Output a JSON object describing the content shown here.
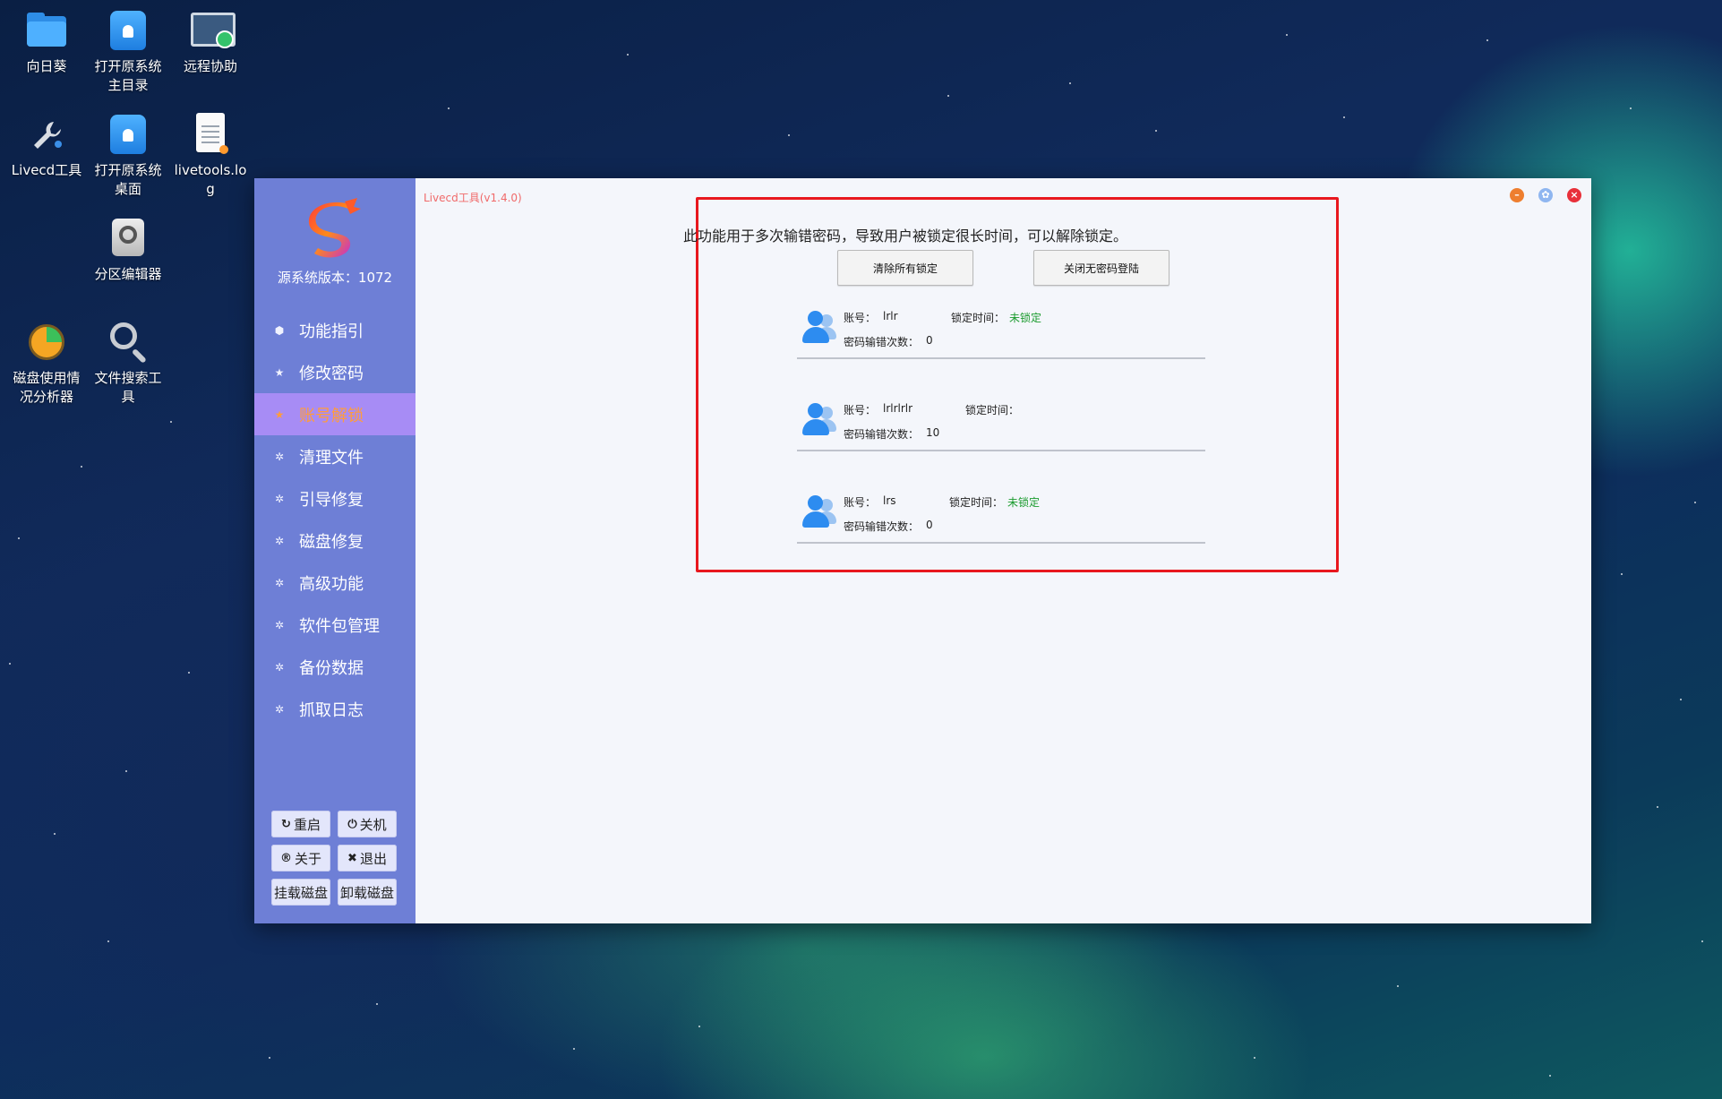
{
  "desktop": {
    "icons": [
      {
        "label": "向日葵"
      },
      {
        "label": "打开原系统主目录"
      },
      {
        "label": "远程协助"
      },
      {
        "label": "Livecd工具"
      },
      {
        "label": "打开原系统桌面"
      },
      {
        "label": "livetools.log"
      },
      {
        "label": "分区编辑器"
      },
      {
        "label": "磁盘使用情况分析器"
      },
      {
        "label": "文件搜索工具"
      }
    ]
  },
  "window": {
    "title": "Livecd工具(v1.4.0)",
    "version_label": "源系统版本：1072",
    "nav": [
      {
        "label": "功能指引",
        "icon": "cube-icon"
      },
      {
        "label": "修改密码",
        "icon": "star-icon"
      },
      {
        "label": "账号解锁",
        "icon": "star-icon",
        "active": true
      },
      {
        "label": "清理文件",
        "icon": "gear-icon"
      },
      {
        "label": "引导修复",
        "icon": "gear-icon"
      },
      {
        "label": "磁盘修复",
        "icon": "gear-icon"
      },
      {
        "label": "高级功能",
        "icon": "gear-icon"
      },
      {
        "label": "软件包管理",
        "icon": "gear-icon"
      },
      {
        "label": "备份数据",
        "icon": "gear-icon"
      },
      {
        "label": "抓取日志",
        "icon": "gear-icon"
      }
    ],
    "side_buttons": {
      "restart": "重启",
      "shutdown": "关机",
      "about": "关于",
      "exit": "退出",
      "mount": "挂载磁盘",
      "unmount": "卸载磁盘"
    },
    "main": {
      "info": "此功能用于多次输错密码，导致用户被锁定很长时间，可以解除锁定。",
      "clear_all_label": "清除所有锁定",
      "close_nopass_label": "关闭无密码登陆",
      "account_label": "账号：",
      "lock_time_label": "锁定时间：",
      "error_count_label": "密码输错次数：",
      "users": [
        {
          "account": "lrlr",
          "lock_status": "未锁定",
          "errors": "0"
        },
        {
          "account": "lrlrlrlr",
          "lock_status": "",
          "errors": "10"
        },
        {
          "account": "lrs",
          "lock_status": "未锁定",
          "errors": "0"
        }
      ]
    }
  },
  "colors": {
    "sidebar": "#6e7fd6",
    "active_nav": "#a78cf5",
    "active_text": "#ff9c3c",
    "highlight_border": "#e8181e",
    "status_green": "#1a9b2e",
    "avatar_blue": "#2d8cf0"
  }
}
